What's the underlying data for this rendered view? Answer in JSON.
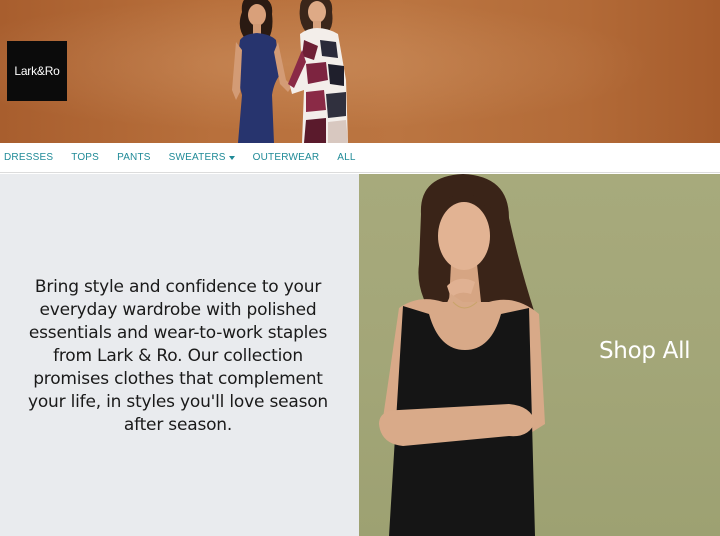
{
  "brand": {
    "logo_text": "Lark&Ro"
  },
  "nav": {
    "items": [
      {
        "label": "DRESSES"
      },
      {
        "label": "TOPS"
      },
      {
        "label": "PANTS"
      },
      {
        "label": "SWEATERS",
        "has_dropdown": true
      },
      {
        "label": "OUTERWEAR"
      },
      {
        "label": "ALL"
      }
    ]
  },
  "intro": {
    "text": "Bring style and confidence to your everyday wardrobe with polished essentials and wear-to-work staples from Lark & Ro. Our collection promises clothes that complement your life, in styles you'll love season after season."
  },
  "promo": {
    "cta_label": "Shop All"
  },
  "colors": {
    "nav_link": "#1f8a97",
    "hero_bg": "#b8703c",
    "left_panel_bg": "#e9ebee",
    "right_panel_bg": "#a7aa7c",
    "logo_bg": "#0b0b0b"
  }
}
